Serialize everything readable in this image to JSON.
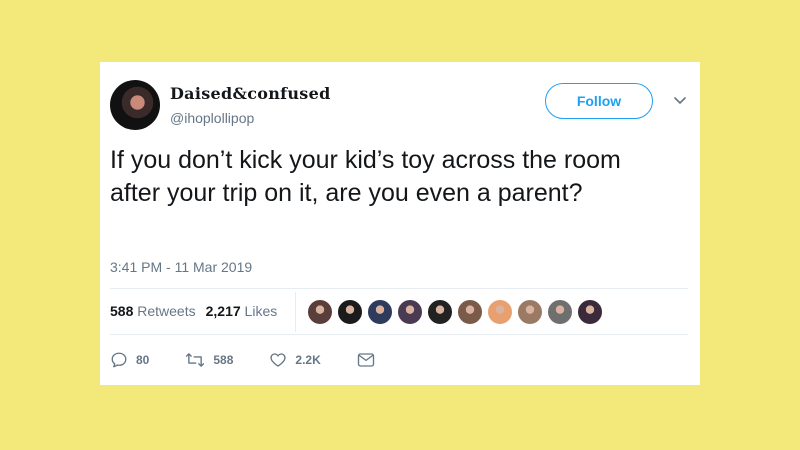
{
  "tweet": {
    "display_name": "Daised&confused",
    "handle": "@ihoplollipop",
    "follow_label": "Follow",
    "text": "If you don’t kick your kid’s toy across the room after your trip on it, are you even a parent?",
    "timestamp": "3:41 PM - 11 Mar 2019",
    "retweets_count": "588",
    "retweets_label": "Retweets",
    "likes_count": "2,217",
    "likes_label": "Likes",
    "reply_count": "80",
    "retweet_action_count": "588",
    "like_action_count": "2.2K"
  },
  "colors": {
    "background": "#f2e97a",
    "accent": "#1da1f2",
    "text": "#14171a",
    "muted": "#657786"
  },
  "icons": [
    "chevron-down-icon",
    "reply-icon",
    "retweet-icon",
    "like-icon",
    "message-icon"
  ],
  "likers": [
    {
      "color": "#5a3e3a"
    },
    {
      "color": "#1b1b1b"
    },
    {
      "color": "#2f3b5c"
    },
    {
      "color": "#4a3a52"
    },
    {
      "color": "#222222"
    },
    {
      "color": "#7a5a48"
    },
    {
      "color": "#e8a070"
    },
    {
      "color": "#9a7a64"
    },
    {
      "color": "#6f6f6f"
    },
    {
      "color": "#3a2a3a"
    }
  ]
}
